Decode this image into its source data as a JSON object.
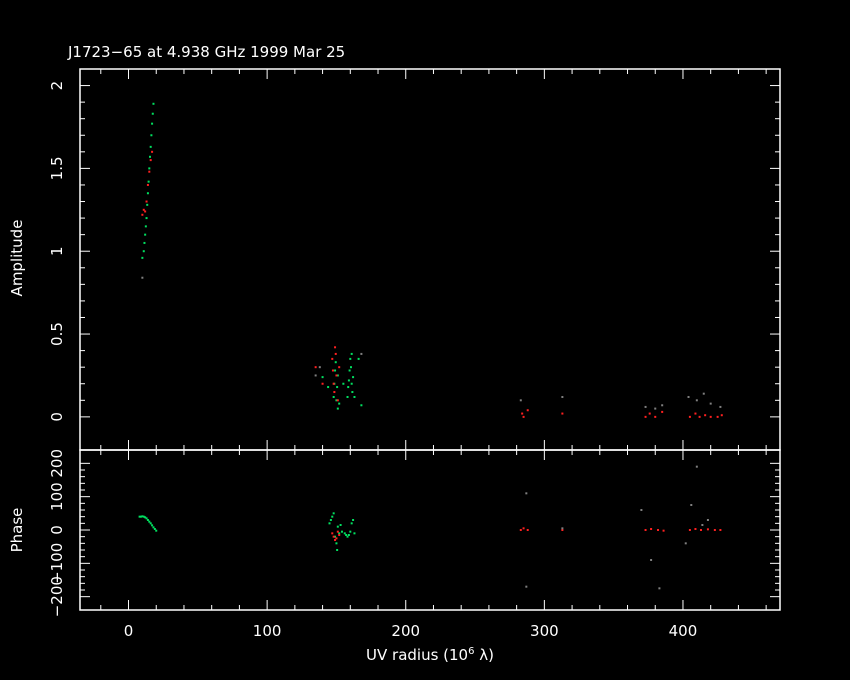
{
  "chart_data": [
    {
      "id": "amplitude",
      "type": "scatter",
      "title": "J1723−65 at 4.938 GHz 1999 Mar 25",
      "ylabel": "Amplitude",
      "xlim": [
        -35,
        470
      ],
      "ylim": [
        -0.2,
        2.1
      ],
      "yticks": [
        "0",
        "0.5",
        "1",
        "1.5",
        "2"
      ],
      "series": [
        {
          "color": "#00e060",
          "points": [
            [
              10,
              0.96
            ],
            [
              11,
              1.0
            ],
            [
              11.5,
              1.05
            ],
            [
              12,
              1.1
            ],
            [
              12.5,
              1.15
            ],
            [
              13,
              1.2
            ],
            [
              13.5,
              1.28
            ],
            [
              14,
              1.35
            ],
            [
              14.5,
              1.42
            ],
            [
              15,
              1.5
            ],
            [
              15.5,
              1.57
            ],
            [
              16,
              1.63
            ],
            [
              16.5,
              1.7
            ],
            [
              17,
              1.77
            ],
            [
              17.5,
              1.83
            ],
            [
              18,
              1.89
            ],
            [
              148,
              0.12
            ],
            [
              148.5,
              0.2
            ],
            [
              149,
              0.28
            ],
            [
              149.5,
              0.33
            ],
            [
              150,
              0.1
            ],
            [
              150.5,
              0.18
            ],
            [
              151,
              0.05
            ],
            [
              151,
              0.25
            ],
            [
              152,
              0.08
            ],
            [
              158,
              0.12
            ],
            [
              158.5,
              0.18
            ],
            [
              159,
              0.22
            ],
            [
              159.5,
              0.28
            ],
            [
              160,
              0.35
            ],
            [
              160.5,
              0.3
            ],
            [
              161,
              0.2
            ],
            [
              161,
              0.38
            ],
            [
              161.5,
              0.15
            ],
            [
              162,
              0.24
            ],
            [
              163,
              0.12
            ],
            [
              140,
              0.24
            ],
            [
              144,
              0.18
            ],
            [
              166,
              0.35
            ],
            [
              168,
              0.07
            ],
            [
              155,
              0.2
            ]
          ]
        },
        {
          "color": "#ff2020",
          "points": [
            [
              10,
              1.22
            ],
            [
              11,
              1.25
            ],
            [
              12,
              1.24
            ],
            [
              13,
              1.3
            ],
            [
              14,
              1.4
            ],
            [
              15,
              1.48
            ],
            [
              16,
              1.55
            ],
            [
              17,
              1.6
            ],
            [
              147,
              0.35
            ],
            [
              147.5,
              0.28
            ],
            [
              148,
              0.2
            ],
            [
              148.5,
              0.15
            ],
            [
              149,
              0.42
            ],
            [
              149.5,
              0.38
            ],
            [
              150,
              0.25
            ],
            [
              151,
              0.1
            ],
            [
              152,
              0.3
            ],
            [
              135,
              0.3
            ],
            [
              140,
              0.2
            ],
            [
              284,
              0.02
            ],
            [
              285,
              0.0
            ],
            [
              288,
              0.04
            ],
            [
              313,
              0.02
            ],
            [
              373,
              0.0
            ],
            [
              376,
              0.02
            ],
            [
              380,
              0.0
            ],
            [
              385,
              0.03
            ],
            [
              405,
              0.0
            ],
            [
              409,
              0.02
            ],
            [
              412,
              0.0
            ],
            [
              416,
              0.01
            ],
            [
              420,
              0.0
            ],
            [
              425,
              0.0
            ],
            [
              428,
              0.01
            ]
          ]
        },
        {
          "color": "#808080",
          "points": [
            [
              10,
              0.84
            ],
            [
              135,
              0.25
            ],
            [
              138,
              0.3
            ],
            [
              168,
              0.38
            ],
            [
              283,
              0.1
            ],
            [
              313,
              0.12
            ],
            [
              373,
              0.06
            ],
            [
              380,
              0.05
            ],
            [
              385,
              0.07
            ],
            [
              404,
              0.12
            ],
            [
              410,
              0.1
            ],
            [
              415,
              0.14
            ],
            [
              420,
              0.08
            ],
            [
              427,
              0.06
            ]
          ]
        }
      ]
    },
    {
      "id": "phase",
      "type": "scatter",
      "title": "",
      "ylabel": "Phase",
      "xlabel": "UV radius  (10",
      "xlabel_sup": "6",
      "xlabel_tail": " λ)",
      "xlim": [
        -35,
        470
      ],
      "ylim": [
        -240,
        240
      ],
      "xticks": [
        "0",
        "100",
        "200",
        "300",
        "400"
      ],
      "yticks": [
        "−200",
        "−100",
        "0",
        "100",
        "200"
      ],
      "series": [
        {
          "color": "#00e060",
          "points": [
            [
              8,
              40
            ],
            [
              9,
              40
            ],
            [
              10,
              41
            ],
            [
              11,
              40
            ],
            [
              12,
              38
            ],
            [
              13,
              35
            ],
            [
              14,
              30
            ],
            [
              15,
              25
            ],
            [
              16,
              20
            ],
            [
              17,
              14
            ],
            [
              18,
              8
            ],
            [
              19,
              3
            ],
            [
              20,
              -2
            ],
            [
              145,
              20
            ],
            [
              146,
              30
            ],
            [
              147,
              40
            ],
            [
              148,
              50
            ],
            [
              149,
              -20
            ],
            [
              150,
              -40
            ],
            [
              150.5,
              -60
            ],
            [
              151,
              10
            ],
            [
              152,
              -10
            ],
            [
              153,
              15
            ],
            [
              154,
              -5
            ],
            [
              156,
              -10
            ],
            [
              157,
              -15
            ],
            [
              158,
              -20
            ],
            [
              159,
              -15
            ],
            [
              160,
              -5
            ],
            [
              161,
              20
            ],
            [
              162,
              30
            ],
            [
              163,
              -10
            ]
          ]
        },
        {
          "color": "#ff2020",
          "points": [
            [
              147,
              -10
            ],
            [
              148,
              -20
            ],
            [
              149,
              -30
            ],
            [
              150,
              -25
            ],
            [
              151,
              -5
            ],
            [
              152,
              -15
            ],
            [
              283,
              0
            ],
            [
              285,
              5
            ],
            [
              288,
              0
            ],
            [
              313,
              0
            ],
            [
              373,
              0
            ],
            [
              377,
              3
            ],
            [
              382,
              0
            ],
            [
              386,
              -2
            ],
            [
              405,
              0
            ],
            [
              409,
              3
            ],
            [
              413,
              0
            ],
            [
              418,
              2
            ],
            [
              423,
              0
            ],
            [
              427,
              0
            ]
          ]
        },
        {
          "color": "#808080",
          "points": [
            [
              287,
              110
            ],
            [
              287,
              -170
            ],
            [
              313,
              5
            ],
            [
              370,
              60
            ],
            [
              377,
              -90
            ],
            [
              383,
              -175
            ],
            [
              402,
              -40
            ],
            [
              406,
              75
            ],
            [
              410,
              190
            ],
            [
              414,
              15
            ],
            [
              418,
              30
            ]
          ]
        }
      ]
    }
  ]
}
